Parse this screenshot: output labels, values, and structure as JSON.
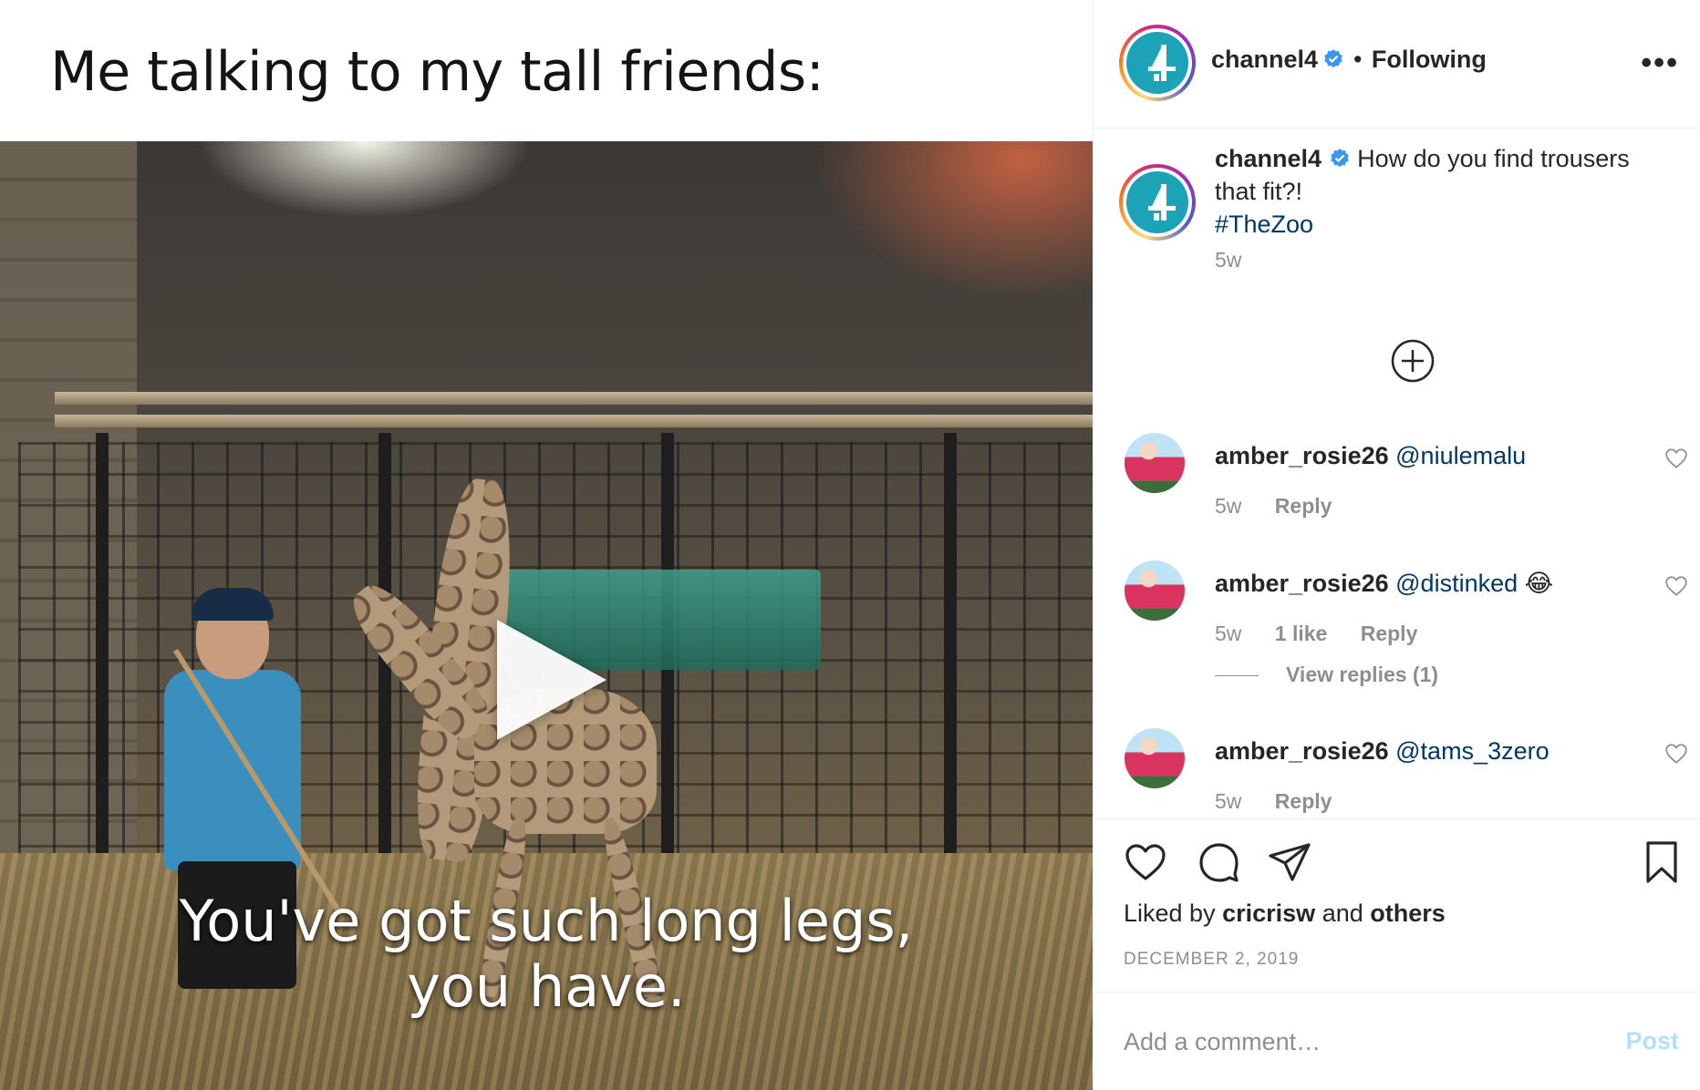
{
  "media": {
    "meme_caption": "Me talking to my tall friends:",
    "subtitle_line1": "You've got such long legs,",
    "subtitle_line2": "you have.",
    "play_icon": "play-icon"
  },
  "header": {
    "username": "channel4",
    "separator": "•",
    "follow_status": "Following",
    "more_label": "•••"
  },
  "caption": {
    "username": "channel4",
    "text": "How do you find trousers that fit?!",
    "hashtag": "#TheZoo",
    "time": "5w"
  },
  "comments": [
    {
      "username": "amber_rosie26",
      "mention": "@niulemalu",
      "emoji": "",
      "time": "5w",
      "likes": "",
      "reply_label": "Reply"
    },
    {
      "username": "amber_rosie26",
      "mention": "@distinked",
      "emoji": "😂",
      "time": "5w",
      "likes": "1 like",
      "reply_label": "Reply",
      "view_replies": "View replies (1)"
    },
    {
      "username": "amber_rosie26",
      "mention": "@tams_3zero",
      "emoji": "",
      "time": "5w",
      "likes": "",
      "reply_label": "Reply"
    }
  ],
  "actions": {
    "liked_prefix": "Liked by",
    "liked_user": "cricrisw",
    "liked_and": "and",
    "liked_others": "others",
    "date": "DECEMBER 2, 2019"
  },
  "add_comment": {
    "placeholder": "Add a comment…",
    "post_label": "Post"
  },
  "colors": {
    "link_blue": "#00376b",
    "verified_blue": "#3897f0",
    "post_disabled": "#b2dffc",
    "secondary_text": "#8e8e8e"
  }
}
